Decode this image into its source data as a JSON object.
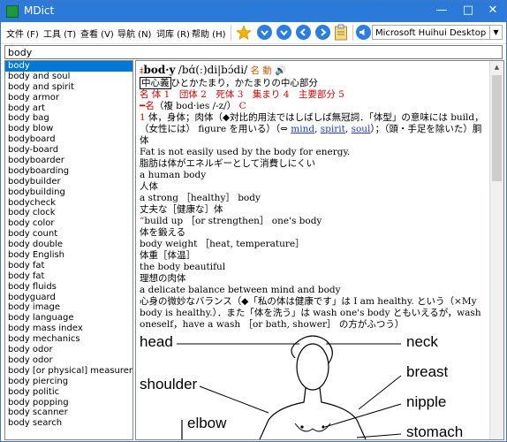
{
  "window": {
    "title": "MDict"
  },
  "menu": [
    {
      "label": "文件 (F)"
    },
    {
      "label": "工具 (T)"
    },
    {
      "label": "查看 (V)"
    },
    {
      "label": "导航 (N)"
    },
    {
      "label": "词库 (R)"
    },
    {
      "label": "帮助 (H)"
    }
  ],
  "toolbar": {
    "dictionary_selected": "Microsoft Huihui Desktop - C",
    "icons": [
      "star-icon",
      "down-arrow-icon",
      "down-arrow-icon",
      "back-icon",
      "forward-icon",
      "clipboard-icon",
      "speaker-icon"
    ]
  },
  "search": {
    "value": "body"
  },
  "wordlist": {
    "selected": "body",
    "items": [
      "body",
      "body and soul",
      "body and spirit",
      "body armor",
      "body art",
      "body bag",
      "body blow",
      "bodyboard",
      "body-board",
      "bodyboarder",
      "bodyboarding",
      "bodybuilder",
      "bodybuilding",
      "bodycheck",
      "body clock",
      "body color",
      "body count",
      "body double",
      "body English",
      "body fat",
      "body fat",
      "body fluids",
      "bodyguard",
      "body image",
      "body language",
      "body mass index",
      "body mechanics",
      "body odor",
      "body odor",
      "body [or physical] measurement",
      "body piercing",
      "body politic",
      "body popping",
      "body scanner",
      "body search"
    ]
  },
  "entry": {
    "headword": "bod·y",
    "pron": "/bɑ́(ː)di|bɔ́di/",
    "pos": "名 動",
    "core_label": "中心義",
    "core_text": "ひとかたまり，かたまりの中心部分",
    "senses_line": "名 体 1　団体 2　死体 3　集まり 4　主要部分 5",
    "noun_label": "━名",
    "plural": "（複 bod·ies /-z/）",
    "countable": "C",
    "s1_num": "1",
    "s1_text": "体，身体；肉体（◆対比的用法ではしばしば無冠詞．「体型」の意味には build，（女性には） figure を用いる）（⇔",
    "link_mind": "mind",
    "link_spirit": "spirit",
    "link_soul": "soul",
    "s1_tail": "）；（頭・手足を除いた）胴体",
    "ex1_en": "Fat is not easily used by the body for energy.",
    "ex1_ja": "脂肪は体がエネルギーとして消費しにくい",
    "ex2_en": "a human body",
    "ex2_ja": "人体",
    "ex3_en": "a strong ［healthy］ body",
    "ex3_ja": "丈夫な［健康な］体",
    "ex4_en": "build up ［or strengthen］ one's body",
    "ex4_ja": "体を鍛える",
    "ex5_en": "body weight ［heat, temperature］",
    "ex5_ja": "体重［体温］",
    "ex6_en": "the body beautiful",
    "ex6_ja": "理想の肉体",
    "ex7_en": "a delicate balance between mind and body",
    "ex7_ja": "心身の微妙なバランス（◆「私の体は健康です」は I am healthy. という（×My body is healthy.）．また「体を洗う」は wash one's body ともいえるが，wash oneself，have a wash ［or bath, shower］ の方がふつう）",
    "illus_labels": {
      "head": "head",
      "neck": "neck",
      "shoulder": "shoulder",
      "breast": "breast",
      "nipple": "nipple",
      "elbow": "elbow",
      "stomach": "stomach"
    }
  },
  "colors": {
    "titlebar": "#2b79d9",
    "selection": "#0078d7",
    "link": "#1a3cc8",
    "accent_red": "#d40000"
  }
}
